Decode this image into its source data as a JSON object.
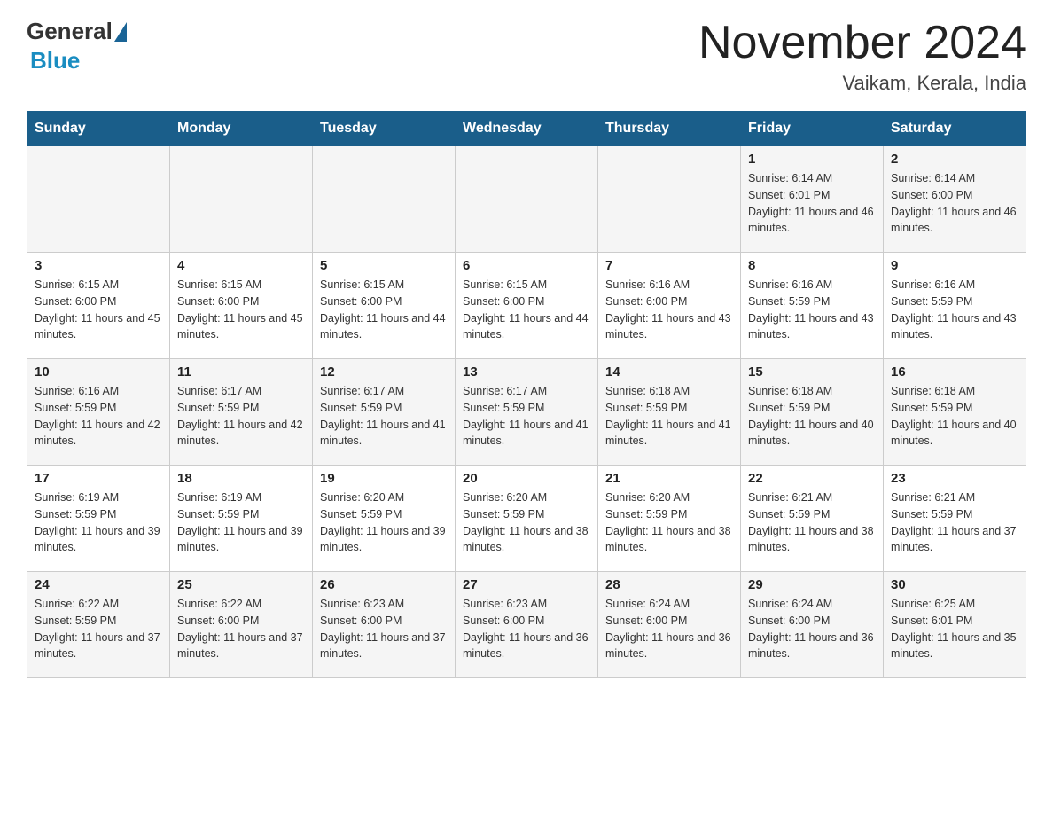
{
  "header": {
    "logo_general": "General",
    "logo_blue": "Blue",
    "title": "November 2024",
    "subtitle": "Vaikam, Kerala, India"
  },
  "days_of_week": [
    "Sunday",
    "Monday",
    "Tuesday",
    "Wednesday",
    "Thursday",
    "Friday",
    "Saturday"
  ],
  "weeks": [
    {
      "days": [
        {
          "number": "",
          "info": ""
        },
        {
          "number": "",
          "info": ""
        },
        {
          "number": "",
          "info": ""
        },
        {
          "number": "",
          "info": ""
        },
        {
          "number": "",
          "info": ""
        },
        {
          "number": "1",
          "info": "Sunrise: 6:14 AM\nSunset: 6:01 PM\nDaylight: 11 hours and 46 minutes."
        },
        {
          "number": "2",
          "info": "Sunrise: 6:14 AM\nSunset: 6:00 PM\nDaylight: 11 hours and 46 minutes."
        }
      ]
    },
    {
      "days": [
        {
          "number": "3",
          "info": "Sunrise: 6:15 AM\nSunset: 6:00 PM\nDaylight: 11 hours and 45 minutes."
        },
        {
          "number": "4",
          "info": "Sunrise: 6:15 AM\nSunset: 6:00 PM\nDaylight: 11 hours and 45 minutes."
        },
        {
          "number": "5",
          "info": "Sunrise: 6:15 AM\nSunset: 6:00 PM\nDaylight: 11 hours and 44 minutes."
        },
        {
          "number": "6",
          "info": "Sunrise: 6:15 AM\nSunset: 6:00 PM\nDaylight: 11 hours and 44 minutes."
        },
        {
          "number": "7",
          "info": "Sunrise: 6:16 AM\nSunset: 6:00 PM\nDaylight: 11 hours and 43 minutes."
        },
        {
          "number": "8",
          "info": "Sunrise: 6:16 AM\nSunset: 5:59 PM\nDaylight: 11 hours and 43 minutes."
        },
        {
          "number": "9",
          "info": "Sunrise: 6:16 AM\nSunset: 5:59 PM\nDaylight: 11 hours and 43 minutes."
        }
      ]
    },
    {
      "days": [
        {
          "number": "10",
          "info": "Sunrise: 6:16 AM\nSunset: 5:59 PM\nDaylight: 11 hours and 42 minutes."
        },
        {
          "number": "11",
          "info": "Sunrise: 6:17 AM\nSunset: 5:59 PM\nDaylight: 11 hours and 42 minutes."
        },
        {
          "number": "12",
          "info": "Sunrise: 6:17 AM\nSunset: 5:59 PM\nDaylight: 11 hours and 41 minutes."
        },
        {
          "number": "13",
          "info": "Sunrise: 6:17 AM\nSunset: 5:59 PM\nDaylight: 11 hours and 41 minutes."
        },
        {
          "number": "14",
          "info": "Sunrise: 6:18 AM\nSunset: 5:59 PM\nDaylight: 11 hours and 41 minutes."
        },
        {
          "number": "15",
          "info": "Sunrise: 6:18 AM\nSunset: 5:59 PM\nDaylight: 11 hours and 40 minutes."
        },
        {
          "number": "16",
          "info": "Sunrise: 6:18 AM\nSunset: 5:59 PM\nDaylight: 11 hours and 40 minutes."
        }
      ]
    },
    {
      "days": [
        {
          "number": "17",
          "info": "Sunrise: 6:19 AM\nSunset: 5:59 PM\nDaylight: 11 hours and 39 minutes."
        },
        {
          "number": "18",
          "info": "Sunrise: 6:19 AM\nSunset: 5:59 PM\nDaylight: 11 hours and 39 minutes."
        },
        {
          "number": "19",
          "info": "Sunrise: 6:20 AM\nSunset: 5:59 PM\nDaylight: 11 hours and 39 minutes."
        },
        {
          "number": "20",
          "info": "Sunrise: 6:20 AM\nSunset: 5:59 PM\nDaylight: 11 hours and 38 minutes."
        },
        {
          "number": "21",
          "info": "Sunrise: 6:20 AM\nSunset: 5:59 PM\nDaylight: 11 hours and 38 minutes."
        },
        {
          "number": "22",
          "info": "Sunrise: 6:21 AM\nSunset: 5:59 PM\nDaylight: 11 hours and 38 minutes."
        },
        {
          "number": "23",
          "info": "Sunrise: 6:21 AM\nSunset: 5:59 PM\nDaylight: 11 hours and 37 minutes."
        }
      ]
    },
    {
      "days": [
        {
          "number": "24",
          "info": "Sunrise: 6:22 AM\nSunset: 5:59 PM\nDaylight: 11 hours and 37 minutes."
        },
        {
          "number": "25",
          "info": "Sunrise: 6:22 AM\nSunset: 6:00 PM\nDaylight: 11 hours and 37 minutes."
        },
        {
          "number": "26",
          "info": "Sunrise: 6:23 AM\nSunset: 6:00 PM\nDaylight: 11 hours and 37 minutes."
        },
        {
          "number": "27",
          "info": "Sunrise: 6:23 AM\nSunset: 6:00 PM\nDaylight: 11 hours and 36 minutes."
        },
        {
          "number": "28",
          "info": "Sunrise: 6:24 AM\nSunset: 6:00 PM\nDaylight: 11 hours and 36 minutes."
        },
        {
          "number": "29",
          "info": "Sunrise: 6:24 AM\nSunset: 6:00 PM\nDaylight: 11 hours and 36 minutes."
        },
        {
          "number": "30",
          "info": "Sunrise: 6:25 AM\nSunset: 6:01 PM\nDaylight: 11 hours and 35 minutes."
        }
      ]
    }
  ]
}
